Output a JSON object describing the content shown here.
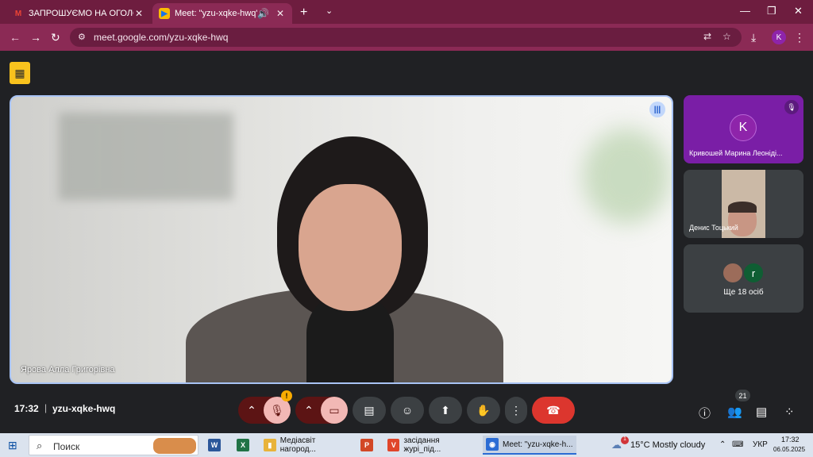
{
  "browser": {
    "tabs": [
      {
        "title": "ЗАПРОШУЄМО НА ОГОЛОШЕ",
        "icon": "gmail-icon"
      },
      {
        "title": "Meet: \"yzu-xqke-hwq\"",
        "icon": "meet-icon"
      }
    ],
    "url": "meet.google.com/yzu-xqke-hwq",
    "profile_initial": "K"
  },
  "meet": {
    "main_speaker": "Ярова Алла Григорівна",
    "tiles": [
      {
        "name": "Кривошей Марина Леоніді...",
        "initial": "K"
      },
      {
        "name": "Денис Тоцький"
      },
      {
        "name": "Ще 18 осіб",
        "initial": "r"
      }
    ],
    "time": "17:32",
    "separator": "|",
    "meeting_code": "yzu-xqke-hwq",
    "mic_alert": "!",
    "participants_count": "21"
  },
  "taskbar": {
    "search_label": "Поиск",
    "apps": [
      {
        "label": "",
        "icon": "W",
        "color": "#2b579a"
      },
      {
        "label": "",
        "icon": "X",
        "color": "#217346"
      },
      {
        "label": "Медіасвіт нагород...",
        "icon": "▮",
        "color": "#e8b33a"
      },
      {
        "label": "",
        "icon": "P",
        "color": "#d24726"
      },
      {
        "label": "засідання журі_під...",
        "icon": "V",
        "color": "#e0452a"
      },
      {
        "label": "Meet: \"yzu-xqke-h...",
        "icon": "◉",
        "color": "#2b6cd4"
      }
    ],
    "weather": "15°C  Mostly cloudy",
    "lang": "УКР",
    "clock_time": "17:32",
    "clock_date": "06.05.2025",
    "weather_badge": "1"
  }
}
